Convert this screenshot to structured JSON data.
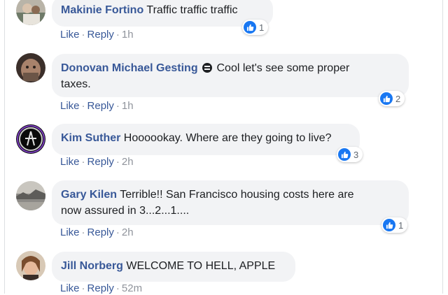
{
  "comments": [
    {
      "author": "Makinie Fortino",
      "text": "Traffic traffic traffic",
      "like_label": "Like",
      "reply_label": "Reply",
      "time": "1h",
      "reactions": "1",
      "separator": "·"
    },
    {
      "author": "Donovan Michael Gesting",
      "text_line1": "Cool let's see some proper",
      "text_line2": "taxes.",
      "like_label": "Like",
      "reply_label": "Reply",
      "time": "1h",
      "reactions": "2",
      "separator": "·"
    },
    {
      "author": "Kim Suther",
      "text": "Hoooookay. Where are they going to live?",
      "like_label": "Like",
      "reply_label": "Reply",
      "time": "2h",
      "reactions": "3",
      "separator": "·"
    },
    {
      "author": "Gary Kilen",
      "text_line1": "Terrible!! San Francisco housing costs here are",
      "text_line2": "now assured in 3...2...1....",
      "like_label": "Like",
      "reply_label": "Reply",
      "time": "2h",
      "reactions": "1",
      "separator": "·"
    },
    {
      "author": "Jill Norberg",
      "text": "WELCOME TO HELL, APPLE",
      "like_label": "Like",
      "reply_label": "Reply",
      "time": "52m",
      "separator": "·"
    }
  ],
  "colors": {
    "author": "#385898",
    "bubble": "#f2f3f5",
    "like_badge": "#1877f2",
    "meta": "#90949c"
  },
  "icons": {
    "reaction": "thumbs-up-icon",
    "badge": "top-fan-badge-icon"
  }
}
